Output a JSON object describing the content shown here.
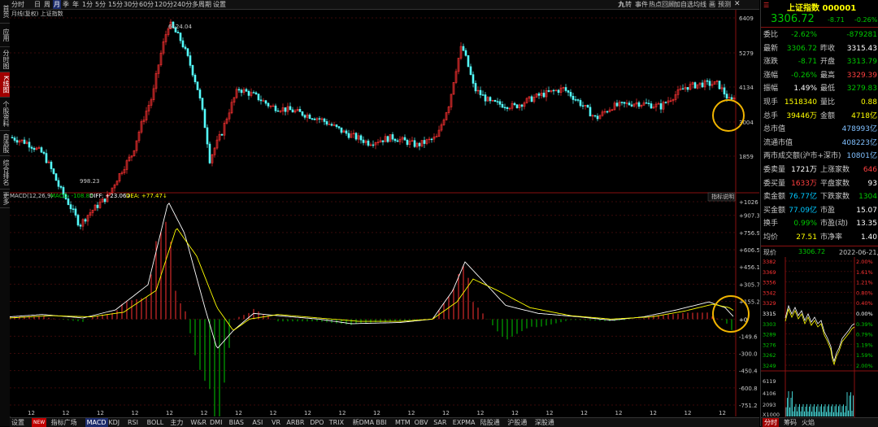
{
  "left_tabs": [
    "首页",
    "应用",
    "分时图",
    "K线图",
    "个股资料",
    "自选股",
    "综合排名",
    "更多"
  ],
  "toolbar": {
    "items": [
      "分时",
      "日",
      "周",
      "月",
      "季",
      "年",
      "1分",
      "5分",
      "15分",
      "30分",
      "60分",
      "120分",
      "240分",
      "多周期",
      "设置"
    ],
    "active": "月",
    "right_items": [
      "九转",
      "事件",
      "热点回顾",
      "加自选",
      "均线",
      "画",
      "预测"
    ],
    "right_icons": [
      "hand-icon",
      "lock-icon",
      "up-icon",
      "down-icon",
      "zoom-in-icon",
      "zoom-out-icon",
      "grid-icon"
    ]
  },
  "kline": {
    "title": "月线(复权)  上证指数",
    "max_label": "6124.04",
    "min_label": "998.23",
    "y_ticks": [
      "6409",
      "5279",
      "4134",
      "3004",
      "1859"
    ]
  },
  "macd": {
    "label": "MACD(12,26,9)",
    "macd_label": "MACD: -108.8↑",
    "diff_label": "DIFF: +23.06↓",
    "dea_label": "DEA: +77.47↓",
    "help_button": "指标说明",
    "y_ticks": [
      "+1026",
      "+907.3",
      "+756.9",
      "+606.5",
      "+456.1",
      "+305.7",
      "+155.2",
      "+0",
      "-149.6",
      "-300.0",
      "-450.4",
      "-600.8",
      "-751.2"
    ],
    "x_labels": [
      "12",
      "12",
      "12",
      "12",
      "12",
      "12",
      "12",
      "12",
      "12",
      "12",
      "12",
      "12",
      "12",
      "12",
      "12",
      "12",
      "12",
      "12",
      "12",
      "12",
      "12",
      "12",
      "12",
      "12"
    ]
  },
  "bottom_bar": {
    "items": [
      "设置",
      "NEW",
      "指标广场",
      "MACD",
      "KDJ",
      "RSI",
      "BOLL",
      "主力",
      "W&R",
      "DMI",
      "BIAS",
      "ASI",
      "VR",
      "ARBR",
      "DPO",
      "TRIX",
      "新DMA",
      "BBI",
      "MTM",
      "OBV",
      "SAR",
      "EXPMA",
      "陆股通",
      "沪股通",
      "深股通"
    ],
    "active": "MACD"
  },
  "quote": {
    "name": "上证指数",
    "code": "000001",
    "price": "3306.72",
    "change": "-8.71",
    "change_pct": "-0.26%",
    "rows": [
      {
        "l1": "委比",
        "v1": "-2.62%",
        "c1": "#00c800",
        "l2": "",
        "v2": "-879281",
        "c2": "#00c800"
      },
      {
        "l1": "最新",
        "v1": "3306.72",
        "c1": "#00c800",
        "l2": "昨收",
        "v2": "3315.43",
        "c2": "#ffffff"
      },
      {
        "l1": "涨跌",
        "v1": "-8.71",
        "c1": "#00c800",
        "l2": "开盘",
        "v2": "3313.79",
        "c2": "#00c800"
      },
      {
        "l1": "涨幅",
        "v1": "-0.26%",
        "c1": "#00c800",
        "l2": "最高",
        "v2": "3329.39",
        "c2": "#ff4040"
      },
      {
        "l1": "振幅",
        "v1": "1.49%",
        "c1": "#ffffff",
        "l2": "最低",
        "v2": "3279.83",
        "c2": "#00c800"
      },
      {
        "l1": "现手",
        "v1": "1518340",
        "c1": "#ffff00",
        "l2": "量比",
        "v2": "0.88",
        "c2": "#ffff00"
      },
      {
        "l1": "总手",
        "v1": "39446万",
        "c1": "#ffff00",
        "l2": "金额",
        "v2": "4718亿",
        "c2": "#ffff00"
      },
      {
        "l1": "总市值",
        "v1": "",
        "c1": "#ffffff",
        "l2": "",
        "v2": "478993亿",
        "c2": "#80c0ff"
      },
      {
        "l1": "流通市值",
        "v1": "",
        "c1": "#ffffff",
        "l2": "",
        "v2": "408223亿",
        "c2": "#80c0ff"
      },
      {
        "l1": "两市成交额(沪市+深市)",
        "v1": "",
        "c1": "#ffffff",
        "l2": "",
        "v2": "10801亿",
        "c2": "#80c0ff"
      },
      {
        "l1": "委卖量",
        "v1": "1721万",
        "c1": "#ffffff",
        "l2": "上涨家数",
        "v2": "646",
        "c2": "#ff4040"
      },
      {
        "l1": "委买量",
        "v1": "1633万",
        "c1": "#ff4040",
        "l2": "平盘家数",
        "v2": "93",
        "c2": "#ffffff"
      },
      {
        "l1": "卖金额",
        "v1": "76.77亿",
        "c1": "#00c8ff",
        "l2": "下跌家数",
        "v2": "1304",
        "c2": "#00c800"
      },
      {
        "l1": "买金额",
        "v1": "77.09亿",
        "c1": "#00c8ff",
        "l2": "市盈",
        "v2": "15.07",
        "c2": "#ffffff"
      },
      {
        "l1": "换手",
        "v1": "0.99%",
        "c1": "#00c800",
        "l2": "市盈(动)",
        "v2": "13.35",
        "c2": "#ffffff"
      },
      {
        "l1": "均价",
        "v1": "27.51",
        "c1": "#ffff00",
        "l2": "市净率",
        "v2": "1.40",
        "c2": "#ffffff"
      }
    ],
    "current_label": "现价",
    "current_value": "3306.72",
    "date": "2022-06-21,二"
  },
  "mini": {
    "price_ticks": [
      "3382",
      "3369",
      "3356",
      "3342",
      "3329",
      "3315",
      "3303",
      "3289",
      "3276",
      "3262",
      "3249"
    ],
    "pct_ticks": [
      "2.00%",
      "1.61%",
      "1.21%",
      "0.80%",
      "0.40%",
      "0.00%",
      "0.39%",
      "0.79%",
      "1.19%",
      "1.59%",
      "2.00%"
    ],
    "vol_ticks": [
      "6119",
      "4106",
      "2093",
      "X1000"
    ],
    "tabs": [
      "分时",
      "筹码",
      "火焰"
    ],
    "active_tab": "分时"
  },
  "colors": {
    "up": "#ff3232",
    "down": "#54ffff",
    "macd_down": "#00c800",
    "diff": "#ffffff",
    "dea": "#ffff00",
    "highlight": "#f0b400"
  }
}
